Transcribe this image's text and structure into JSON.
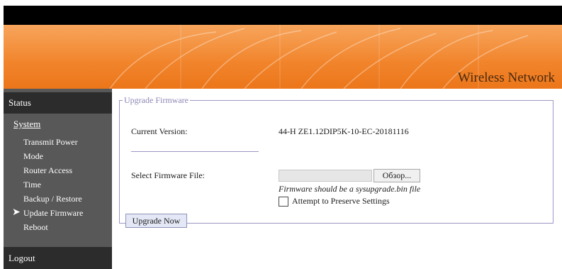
{
  "header": {
    "title": "Wireless Network"
  },
  "sidebar": {
    "status": "Status",
    "system": "System",
    "items": [
      {
        "label": "Transmit Power"
      },
      {
        "label": "Mode"
      },
      {
        "label": "Router Access"
      },
      {
        "label": "Time"
      },
      {
        "label": "Backup / Restore"
      },
      {
        "label": "Update Firmware",
        "active": true
      },
      {
        "label": "Reboot"
      }
    ],
    "logout": "Logout"
  },
  "firmware": {
    "legend": "Upgrade Firmware",
    "current_version_label": "Current Version:",
    "current_version_value": "44-H ZE1.12DIP5K-10-EC-20181116",
    "select_file_label": "Select Firmware File:",
    "browse_label": "Обзор...",
    "hint": "Firmware should be a sysupgrade.bin file",
    "preserve_label": "Attempt to Preserve Settings",
    "preserve_checked": false,
    "upgrade_button": "Upgrade Now"
  },
  "colors": {
    "banner": "#f1842b",
    "sidebar": "#585858",
    "sidebar_header": "#2c2c2c",
    "fieldset_border": "#9c97c5"
  }
}
